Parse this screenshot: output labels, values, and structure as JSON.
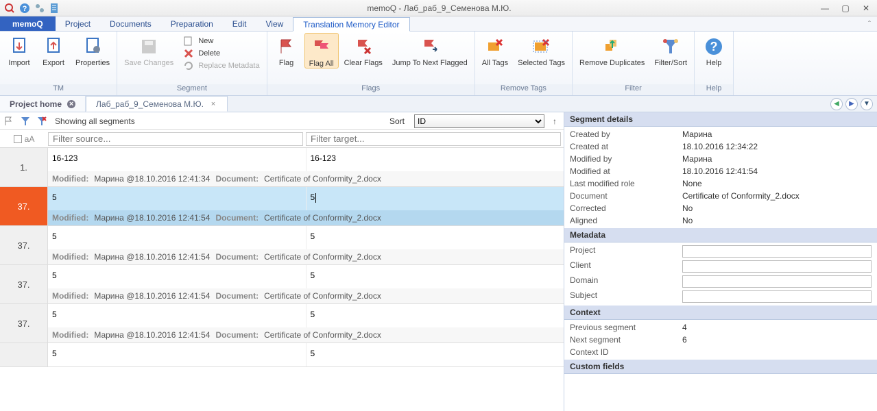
{
  "titlebar": {
    "title": "memoQ - Лаб_раб_9_Семенова М.Ю."
  },
  "menu": {
    "brand": "memoQ",
    "tabs": [
      "Project",
      "Documents",
      "Preparation",
      "Edit",
      "View",
      "Translation Memory Editor"
    ],
    "active": 5
  },
  "ribbon": {
    "groups": {
      "tm": {
        "label": "TM",
        "import": "Import",
        "export": "Export",
        "properties": "Properties"
      },
      "segment": {
        "label": "Segment",
        "save": "Save Changes",
        "new": "New",
        "delete": "Delete",
        "replace": "Replace Metadata"
      },
      "flags": {
        "label": "Flags",
        "flag": "Flag",
        "flagall": "Flag All",
        "clear": "Clear Flags",
        "jump": "Jump To Next Flagged"
      },
      "removetags": {
        "label": "Remove Tags",
        "alltags": "All Tags",
        "seltags": "Selected Tags"
      },
      "filter": {
        "label": "Filter",
        "dup": "Remove Duplicates",
        "sort": "Filter/Sort"
      },
      "help": {
        "label": "Help",
        "help": "Help"
      }
    }
  },
  "doctabs": {
    "home": "Project home",
    "file": "Лаб_раб_9_Семенова М.Ю."
  },
  "filterbar": {
    "status": "Showing all segments",
    "sortlabel": "Sort",
    "sortvalue": "ID"
  },
  "filterinputs": {
    "case": "aA",
    "src_ph": "Filter source...",
    "tgt_ph": "Filter target..."
  },
  "rows": [
    {
      "num": "1.",
      "src": "16-123",
      "tgt": "16-123",
      "mod": "Марина @18.10.2016 12:41:34",
      "doc": "Certificate of Conformity_2.docx",
      "sel": false
    },
    {
      "num": "37.",
      "src": "5",
      "tgt": "5",
      "mod": "Марина @18.10.2016 12:41:54",
      "doc": "Certificate of Conformity_2.docx",
      "sel": true
    },
    {
      "num": "37.",
      "src": "5",
      "tgt": "5",
      "mod": "Марина @18.10.2016 12:41:54",
      "doc": "Certificate of Conformity_2.docx",
      "sel": false
    },
    {
      "num": "37.",
      "src": "5",
      "tgt": "5",
      "mod": "Марина @18.10.2016 12:41:54",
      "doc": "Certificate of Conformity_2.docx",
      "sel": false
    },
    {
      "num": "37.",
      "src": "5",
      "tgt": "5",
      "mod": "Марина @18.10.2016 12:41:54",
      "doc": "Certificate of Conformity_2.docx",
      "sel": false
    }
  ],
  "meta_labels": {
    "modified": "Modified:",
    "document": "Document:"
  },
  "details": {
    "title": "Segment details",
    "items": [
      {
        "k": "Created by",
        "v": "Марина"
      },
      {
        "k": "Created at",
        "v": "18.10.2016 12:34:22"
      },
      {
        "k": "Modified by",
        "v": "Марина"
      },
      {
        "k": "Modified at",
        "v": "18.10.2016 12:41:54"
      },
      {
        "k": "Last modified role",
        "v": "None"
      },
      {
        "k": "Document",
        "v": "Certificate of Conformity_2.docx"
      },
      {
        "k": "Corrected",
        "v": "No"
      },
      {
        "k": "Aligned",
        "v": "No"
      }
    ],
    "metatitle": "Metadata",
    "metafields": [
      "Project",
      "Client",
      "Domain",
      "Subject"
    ],
    "ctxtitle": "Context",
    "ctx": [
      {
        "k": "Previous segment",
        "v": "4"
      },
      {
        "k": "Next segment",
        "v": "6"
      },
      {
        "k": "Context ID",
        "v": ""
      }
    ],
    "cftitle": "Custom fields"
  }
}
